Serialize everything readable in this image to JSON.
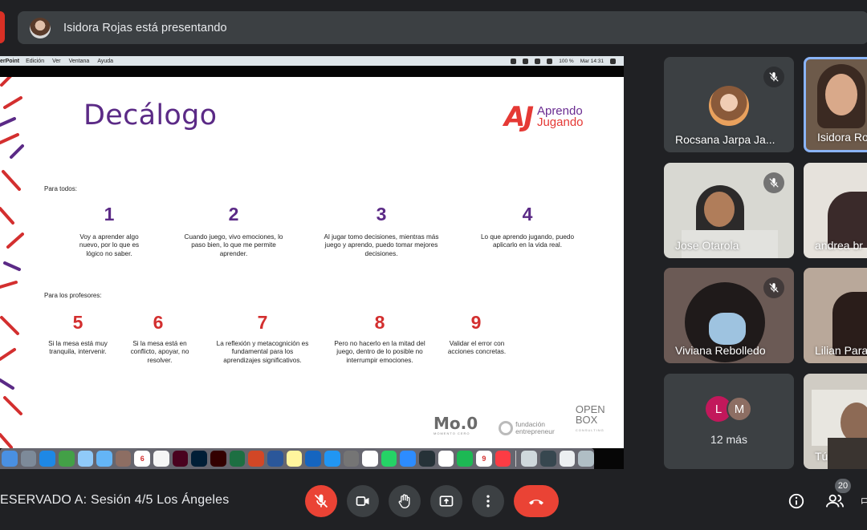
{
  "presenter_bar": {
    "text": "Isidora Rojas está presentando"
  },
  "shared_screen": {
    "menubar": {
      "app": "erPoint",
      "items": [
        "Edición",
        "Ver",
        "Ventana",
        "Ayuda"
      ],
      "battery": "100 %",
      "clock": "Mar 14:31"
    },
    "slide": {
      "title": "Decálogo",
      "logo": {
        "mark": "AJ",
        "line1": "Aprendo",
        "line2": "Jugando"
      },
      "section_all": "Para todos:",
      "section_teachers": "Para los profesores:",
      "rules_all": [
        {
          "num": "1",
          "text": "Voy a aprender algo nuevo, por lo que es lógico no saber."
        },
        {
          "num": "2",
          "text": "Cuando juego, vivo emociones, lo paso bien, lo que me permite aprender."
        },
        {
          "num": "3",
          "text": "Al jugar tomo decisiones, mientras más juego y aprendo, puedo tomar mejores decisiones."
        },
        {
          "num": "4",
          "text": "Lo que aprendo jugando, puedo aplicarlo en la vida real."
        }
      ],
      "rules_teachers": [
        {
          "num": "5",
          "text": "Si la mesa está muy tranquila, intervenir."
        },
        {
          "num": "6",
          "text": "Si la mesa está en conflicto, apoyar, no resolver."
        },
        {
          "num": "7",
          "text": "La reflexión y metacognición es fundamental para los aprendizajes significativos."
        },
        {
          "num": "8",
          "text": "Pero no hacerlo en la mitad del juego, dentro de lo posible no interrumpir emociones."
        },
        {
          "num": "9",
          "text": "Validar el error con acciones concretas."
        }
      ],
      "partners": {
        "mo": "Mo.0",
        "mo_sub": "MOMENTO CERO",
        "fund_l1": "fundación",
        "fund_l2": "entrepreneur",
        "ob_l1": "OPEN",
        "ob_l2": "BOX",
        "ob_sub": "CONSULTING"
      },
      "dock_calendar_day": "6",
      "dock_badge": "9"
    }
  },
  "participants": [
    {
      "name": "Rocsana Jarpa Ja...",
      "muted": true
    },
    {
      "name": "Isidora Ro",
      "muted": false,
      "selected": true
    },
    {
      "name": "Jose Otarola",
      "muted": true
    },
    {
      "name": "andrea br",
      "muted": false
    },
    {
      "name": "Viviana Rebolledo",
      "muted": true
    },
    {
      "name": "Lilian Para",
      "muted": false
    },
    {
      "name": "12 más",
      "initials": [
        "L",
        "M"
      ]
    },
    {
      "name": "Tú",
      "muted": false
    }
  ],
  "bottom_bar": {
    "meeting_name": "ESERVADO A: Sesión 4/5 Los Ángeles",
    "participant_count": "20"
  },
  "colors": {
    "meet_bg": "#202124",
    "tile_bg": "#3c4043",
    "danger": "#ea4335",
    "slide_purple": "#5b2a86",
    "slide_red": "#d32f2f"
  }
}
